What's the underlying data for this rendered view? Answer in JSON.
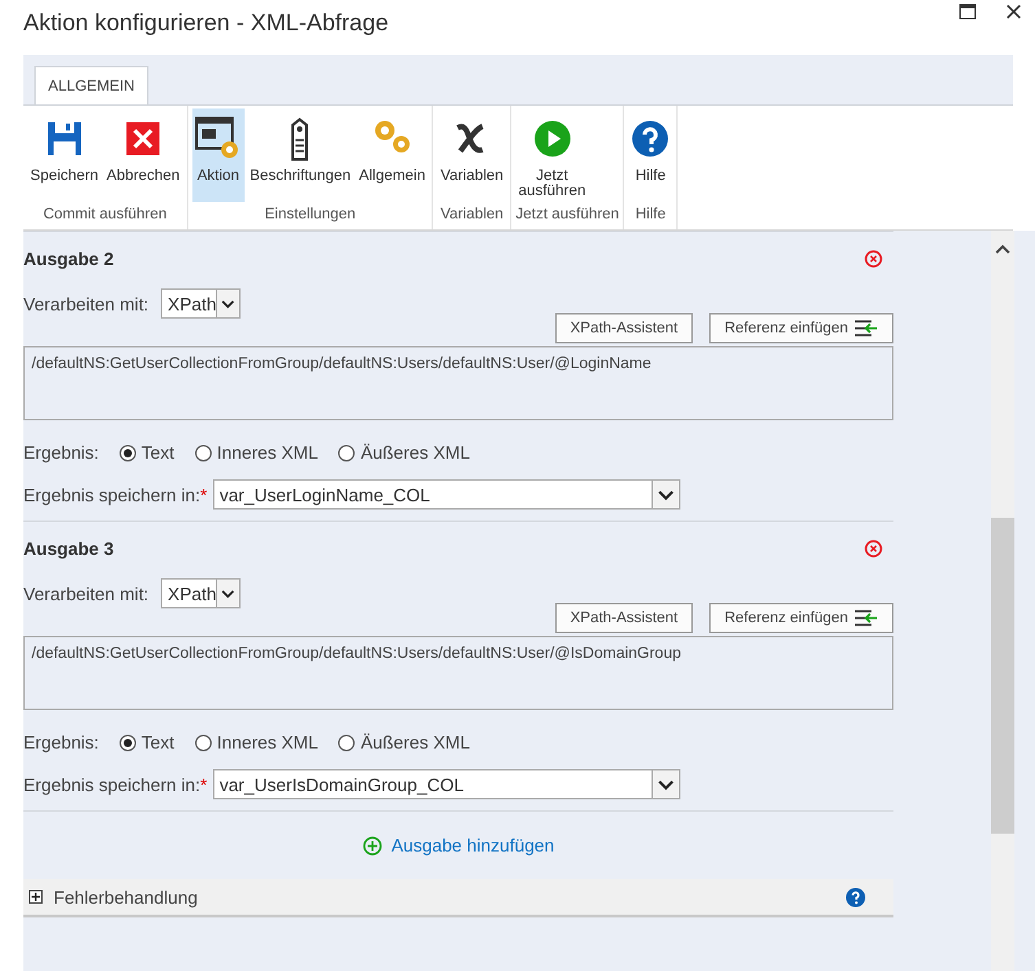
{
  "window": {
    "title": "Aktion konfigurieren - XML-Abfrage"
  },
  "ribbon": {
    "tabs": [
      {
        "label": "ALLGEMEIN",
        "selected": true
      }
    ],
    "groups": [
      {
        "label": "Commit ausführen",
        "buttons": [
          {
            "label": "Speichern",
            "selected": false
          },
          {
            "label": "Abbrechen",
            "selected": false
          }
        ]
      },
      {
        "label": "Einstellungen",
        "buttons": [
          {
            "label": "Aktion",
            "selected": true
          },
          {
            "label": "Beschriftungen",
            "selected": false
          },
          {
            "label": "Allgemein",
            "selected": false
          }
        ]
      },
      {
        "label": "Variablen",
        "buttons": [
          {
            "label": "Variablen",
            "selected": false
          }
        ]
      },
      {
        "label": "Jetzt ausführen",
        "buttons": [
          {
            "label": "Jetzt ausführen",
            "selected": false
          }
        ]
      },
      {
        "label": "Hilfe",
        "buttons": [
          {
            "label": "Hilfe",
            "selected": false
          }
        ]
      }
    ]
  },
  "outputs": [
    {
      "title": "Ausgabe 2",
      "process_label": "Verarbeiten mit:",
      "process_value": "XPath",
      "xpath_button": "XPath-Assistent",
      "reference_button": "Referenz einfügen",
      "expression": "/defaultNS:GetUserCollectionFromGroup/defaultNS:Users/defaultNS:User/@LoginName",
      "result_label": "Ergebnis:",
      "result_options": [
        {
          "label": "Text",
          "selected": true
        },
        {
          "label": "Inneres XML",
          "selected": false
        },
        {
          "label": "Äußeres XML",
          "selected": false
        }
      ],
      "save_label": "Ergebnis speichern in:",
      "required_mark": "*",
      "save_value": "var_UserLoginName_COL"
    },
    {
      "title": "Ausgabe 3",
      "process_label": "Verarbeiten mit:",
      "process_value": "XPath",
      "xpath_button": "XPath-Assistent",
      "reference_button": "Referenz einfügen",
      "expression": "/defaultNS:GetUserCollectionFromGroup/defaultNS:Users/defaultNS:User/@IsDomainGroup",
      "result_label": "Ergebnis:",
      "result_options": [
        {
          "label": "Text",
          "selected": true
        },
        {
          "label": "Inneres XML",
          "selected": false
        },
        {
          "label": "Äußeres XML",
          "selected": false
        }
      ],
      "save_label": "Ergebnis speichern in:",
      "required_mark": "*",
      "save_value": "var_UserIsDomainGroup_COL"
    }
  ],
  "add_output": "Ausgabe hinzufügen",
  "error_handling": {
    "label": "Fehlerbehandlung",
    "expanded": false
  }
}
